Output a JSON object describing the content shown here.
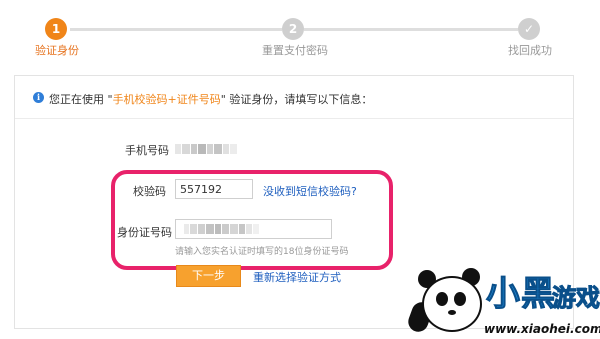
{
  "steps": [
    {
      "number": "1",
      "label": "验证身份",
      "state": "active"
    },
    {
      "number": "2",
      "label": "重置支付密码",
      "state": "todo"
    },
    {
      "number": "✓",
      "label": "找回成功",
      "state": "todo"
    }
  ],
  "notice": {
    "prefix": "您正在使用 \"",
    "highlight": "手机校验码+证件号码",
    "suffix": "\" 验证身份，请填写以下信息："
  },
  "form": {
    "phone_label": "手机号码",
    "code_label": "校验码",
    "code_value": "557192",
    "no_sms_link": "没收到短信校验码?",
    "id_label": "身份证号码",
    "id_hint": "请输入您实名认证时填写的18位身份证号码",
    "next_button": "下一步",
    "reselect_link": "重新选择验证方式"
  },
  "watermark": {
    "brand_cn": "小黑",
    "brand_cn2": "游戏",
    "brand_en": "www.xiaohei.com"
  },
  "colors": {
    "accent": "#f08519",
    "link": "#1f5fbf",
    "highlight_box": "#e8226a",
    "button": "#f7a12e"
  }
}
